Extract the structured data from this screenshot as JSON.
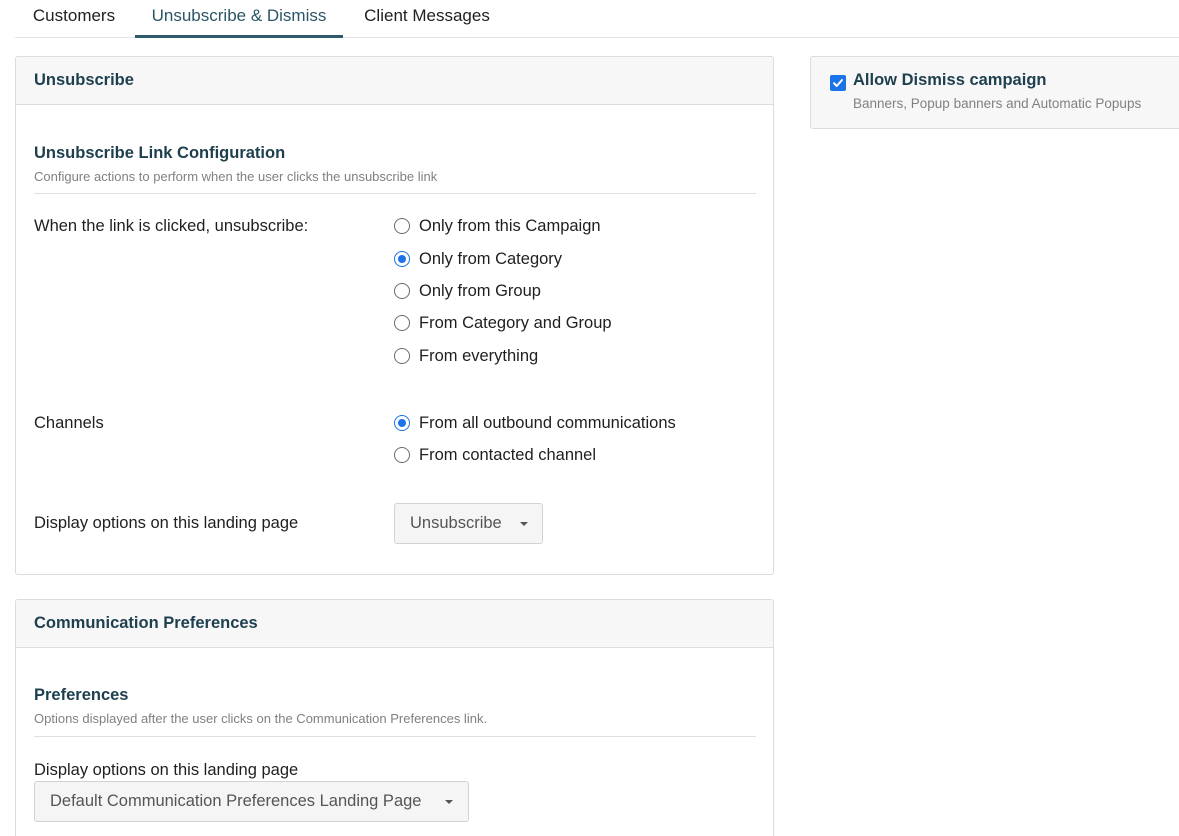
{
  "tabs": [
    {
      "label": "Customers",
      "active": false
    },
    {
      "label": "Unsubscribe & Dismiss",
      "active": true
    },
    {
      "label": "Client Messages",
      "active": false
    }
  ],
  "unsubscribe_panel": {
    "header": "Unsubscribe",
    "section_title": "Unsubscribe Link Configuration",
    "section_subtitle": "Configure actions to perform when the user clicks the unsubscribe link",
    "link_clicked_label": "When the link is clicked, unsubscribe:",
    "link_options": [
      {
        "label": "Only from this Campaign",
        "checked": false
      },
      {
        "label": "Only from Category",
        "checked": true
      },
      {
        "label": "Only from Group",
        "checked": false
      },
      {
        "label": "From Category and Group",
        "checked": false
      },
      {
        "label": "From everything",
        "checked": false
      }
    ],
    "channels_label": "Channels",
    "channel_options": [
      {
        "label": "From all outbound communications",
        "checked": true
      },
      {
        "label": "From contacted channel",
        "checked": false
      }
    ],
    "display_label": "Display options on this landing page",
    "display_value": "Unsubscribe"
  },
  "preferences_panel": {
    "header": "Communication Preferences",
    "section_title": "Preferences",
    "section_subtitle": "Options displayed after the user clicks on the Communication Preferences link.",
    "display_label": "Display options on this landing page",
    "display_value": "Default Communication Preferences Landing Page"
  },
  "dismiss_card": {
    "checked": true,
    "title": "Allow Dismiss campaign",
    "subtitle": "Banners, Popup banners and Automatic Popups"
  },
  "colors": {
    "accent": "#1a73e8",
    "heading": "#1d3f4e",
    "tab_active": "#2e5a6b"
  }
}
